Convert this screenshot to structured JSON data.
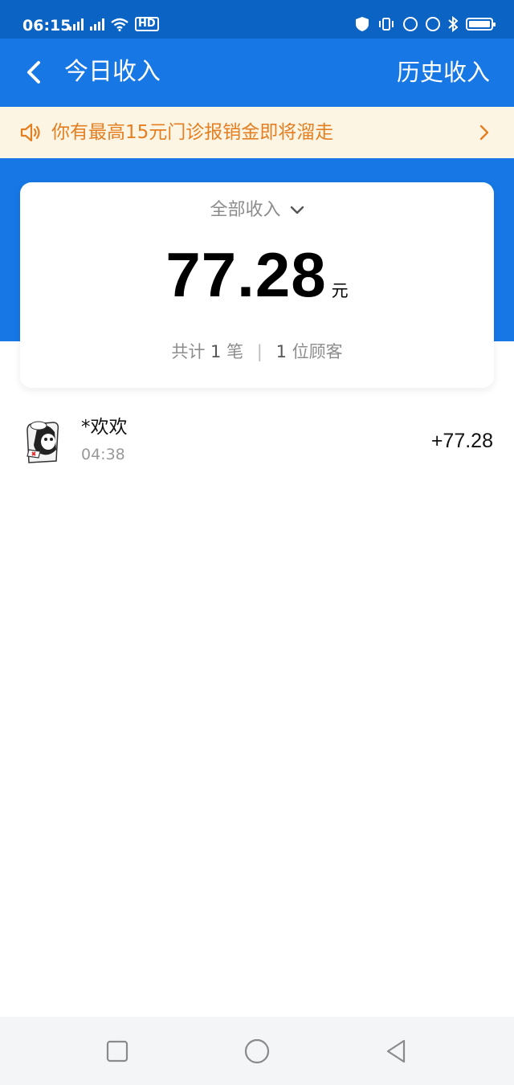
{
  "status_bar": {
    "time": "06:15",
    "signal1_tag": "4G",
    "signal2_tag": "4G+",
    "hd_tag": "HD",
    "battery_level": 1.0
  },
  "nav": {
    "title": "今日收入",
    "history": "历史收入"
  },
  "notice": {
    "text": "你有最高15元门诊报销金即将溜走"
  },
  "summary": {
    "filter_label": "全部收入",
    "amount": "77.28",
    "unit": "元",
    "stats_prefix": "共计",
    "count": "1",
    "count_unit": "笔",
    "customers": "1",
    "customers_unit": "位顾客"
  },
  "transactions": [
    {
      "name": "*欢欢",
      "time": "04:38",
      "amount": "+77.28"
    }
  ],
  "colors": {
    "brand_blue": "#1677e5",
    "status_blue": "#0b63c4",
    "notice_bg": "#fdf5e3",
    "notice_text": "#e47e21"
  }
}
